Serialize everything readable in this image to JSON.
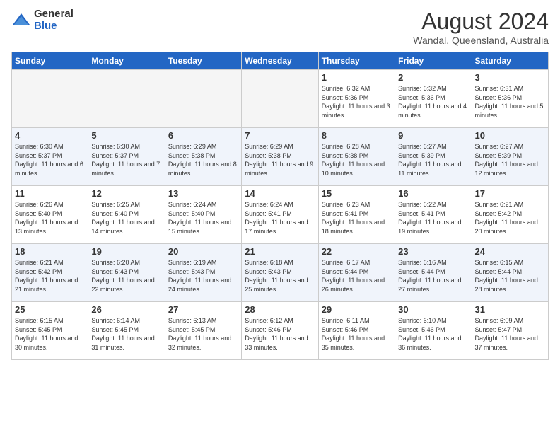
{
  "logo": {
    "general": "General",
    "blue": "Blue"
  },
  "title": "August 2024",
  "subtitle": "Wandal, Queensland, Australia",
  "weekdays": [
    "Sunday",
    "Monday",
    "Tuesday",
    "Wednesday",
    "Thursday",
    "Friday",
    "Saturday"
  ],
  "weeks": [
    [
      {
        "day": "",
        "sunrise": "",
        "sunset": "",
        "daylight": "",
        "empty": true
      },
      {
        "day": "",
        "sunrise": "",
        "sunset": "",
        "daylight": "",
        "empty": true
      },
      {
        "day": "",
        "sunrise": "",
        "sunset": "",
        "daylight": "",
        "empty": true
      },
      {
        "day": "",
        "sunrise": "",
        "sunset": "",
        "daylight": "",
        "empty": true
      },
      {
        "day": "1",
        "sunrise": "Sunrise: 6:32 AM",
        "sunset": "Sunset: 5:36 PM",
        "daylight": "Daylight: 11 hours and 3 minutes.",
        "empty": false
      },
      {
        "day": "2",
        "sunrise": "Sunrise: 6:32 AM",
        "sunset": "Sunset: 5:36 PM",
        "daylight": "Daylight: 11 hours and 4 minutes.",
        "empty": false
      },
      {
        "day": "3",
        "sunrise": "Sunrise: 6:31 AM",
        "sunset": "Sunset: 5:36 PM",
        "daylight": "Daylight: 11 hours and 5 minutes.",
        "empty": false
      }
    ],
    [
      {
        "day": "4",
        "sunrise": "Sunrise: 6:30 AM",
        "sunset": "Sunset: 5:37 PM",
        "daylight": "Daylight: 11 hours and 6 minutes.",
        "empty": false
      },
      {
        "day": "5",
        "sunrise": "Sunrise: 6:30 AM",
        "sunset": "Sunset: 5:37 PM",
        "daylight": "Daylight: 11 hours and 7 minutes.",
        "empty": false
      },
      {
        "day": "6",
        "sunrise": "Sunrise: 6:29 AM",
        "sunset": "Sunset: 5:38 PM",
        "daylight": "Daylight: 11 hours and 8 minutes.",
        "empty": false
      },
      {
        "day": "7",
        "sunrise": "Sunrise: 6:29 AM",
        "sunset": "Sunset: 5:38 PM",
        "daylight": "Daylight: 11 hours and 9 minutes.",
        "empty": false
      },
      {
        "day": "8",
        "sunrise": "Sunrise: 6:28 AM",
        "sunset": "Sunset: 5:38 PM",
        "daylight": "Daylight: 11 hours and 10 minutes.",
        "empty": false
      },
      {
        "day": "9",
        "sunrise": "Sunrise: 6:27 AM",
        "sunset": "Sunset: 5:39 PM",
        "daylight": "Daylight: 11 hours and 11 minutes.",
        "empty": false
      },
      {
        "day": "10",
        "sunrise": "Sunrise: 6:27 AM",
        "sunset": "Sunset: 5:39 PM",
        "daylight": "Daylight: 11 hours and 12 minutes.",
        "empty": false
      }
    ],
    [
      {
        "day": "11",
        "sunrise": "Sunrise: 6:26 AM",
        "sunset": "Sunset: 5:40 PM",
        "daylight": "Daylight: 11 hours and 13 minutes.",
        "empty": false
      },
      {
        "day": "12",
        "sunrise": "Sunrise: 6:25 AM",
        "sunset": "Sunset: 5:40 PM",
        "daylight": "Daylight: 11 hours and 14 minutes.",
        "empty": false
      },
      {
        "day": "13",
        "sunrise": "Sunrise: 6:24 AM",
        "sunset": "Sunset: 5:40 PM",
        "daylight": "Daylight: 11 hours and 15 minutes.",
        "empty": false
      },
      {
        "day": "14",
        "sunrise": "Sunrise: 6:24 AM",
        "sunset": "Sunset: 5:41 PM",
        "daylight": "Daylight: 11 hours and 17 minutes.",
        "empty": false
      },
      {
        "day": "15",
        "sunrise": "Sunrise: 6:23 AM",
        "sunset": "Sunset: 5:41 PM",
        "daylight": "Daylight: 11 hours and 18 minutes.",
        "empty": false
      },
      {
        "day": "16",
        "sunrise": "Sunrise: 6:22 AM",
        "sunset": "Sunset: 5:41 PM",
        "daylight": "Daylight: 11 hours and 19 minutes.",
        "empty": false
      },
      {
        "day": "17",
        "sunrise": "Sunrise: 6:21 AM",
        "sunset": "Sunset: 5:42 PM",
        "daylight": "Daylight: 11 hours and 20 minutes.",
        "empty": false
      }
    ],
    [
      {
        "day": "18",
        "sunrise": "Sunrise: 6:21 AM",
        "sunset": "Sunset: 5:42 PM",
        "daylight": "Daylight: 11 hours and 21 minutes.",
        "empty": false
      },
      {
        "day": "19",
        "sunrise": "Sunrise: 6:20 AM",
        "sunset": "Sunset: 5:43 PM",
        "daylight": "Daylight: 11 hours and 22 minutes.",
        "empty": false
      },
      {
        "day": "20",
        "sunrise": "Sunrise: 6:19 AM",
        "sunset": "Sunset: 5:43 PM",
        "daylight": "Daylight: 11 hours and 24 minutes.",
        "empty": false
      },
      {
        "day": "21",
        "sunrise": "Sunrise: 6:18 AM",
        "sunset": "Sunset: 5:43 PM",
        "daylight": "Daylight: 11 hours and 25 minutes.",
        "empty": false
      },
      {
        "day": "22",
        "sunrise": "Sunrise: 6:17 AM",
        "sunset": "Sunset: 5:44 PM",
        "daylight": "Daylight: 11 hours and 26 minutes.",
        "empty": false
      },
      {
        "day": "23",
        "sunrise": "Sunrise: 6:16 AM",
        "sunset": "Sunset: 5:44 PM",
        "daylight": "Daylight: 11 hours and 27 minutes.",
        "empty": false
      },
      {
        "day": "24",
        "sunrise": "Sunrise: 6:15 AM",
        "sunset": "Sunset: 5:44 PM",
        "daylight": "Daylight: 11 hours and 28 minutes.",
        "empty": false
      }
    ],
    [
      {
        "day": "25",
        "sunrise": "Sunrise: 6:15 AM",
        "sunset": "Sunset: 5:45 PM",
        "daylight": "Daylight: 11 hours and 30 minutes.",
        "empty": false
      },
      {
        "day": "26",
        "sunrise": "Sunrise: 6:14 AM",
        "sunset": "Sunset: 5:45 PM",
        "daylight": "Daylight: 11 hours and 31 minutes.",
        "empty": false
      },
      {
        "day": "27",
        "sunrise": "Sunrise: 6:13 AM",
        "sunset": "Sunset: 5:45 PM",
        "daylight": "Daylight: 11 hours and 32 minutes.",
        "empty": false
      },
      {
        "day": "28",
        "sunrise": "Sunrise: 6:12 AM",
        "sunset": "Sunset: 5:46 PM",
        "daylight": "Daylight: 11 hours and 33 minutes.",
        "empty": false
      },
      {
        "day": "29",
        "sunrise": "Sunrise: 6:11 AM",
        "sunset": "Sunset: 5:46 PM",
        "daylight": "Daylight: 11 hours and 35 minutes.",
        "empty": false
      },
      {
        "day": "30",
        "sunrise": "Sunrise: 6:10 AM",
        "sunset": "Sunset: 5:46 PM",
        "daylight": "Daylight: 11 hours and 36 minutes.",
        "empty": false
      },
      {
        "day": "31",
        "sunrise": "Sunrise: 6:09 AM",
        "sunset": "Sunset: 5:47 PM",
        "daylight": "Daylight: 11 hours and 37 minutes.",
        "empty": false
      }
    ]
  ]
}
